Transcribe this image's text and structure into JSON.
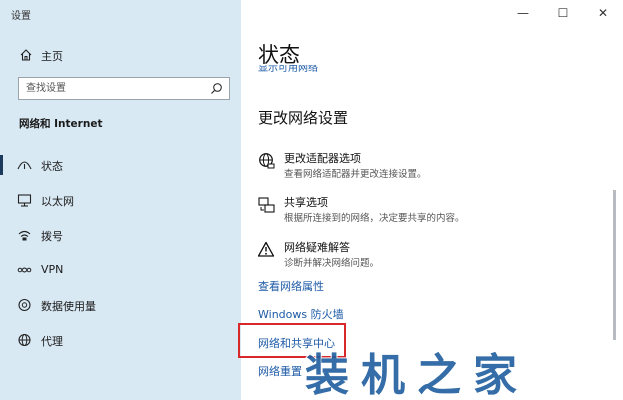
{
  "window": {
    "title": "设置"
  },
  "sidebar": {
    "home_label": "主页",
    "search_placeholder": "查找设置",
    "section_title": "网络和 Internet",
    "items": [
      {
        "label": "状态",
        "icon": "status-icon",
        "active": true
      },
      {
        "label": "以太网",
        "icon": "ethernet-icon"
      },
      {
        "label": "拨号",
        "icon": "dialup-icon"
      },
      {
        "label": "VPN",
        "icon": "vpn-icon"
      },
      {
        "label": "数据使用量",
        "icon": "data-usage-icon"
      },
      {
        "label": "代理",
        "icon": "proxy-icon"
      }
    ]
  },
  "window_controls": {
    "minimize": "—",
    "maximize": "☐",
    "close": "✕"
  },
  "main": {
    "title": "状态",
    "cut_link": "显示可用网络",
    "subtitle": "更改网络设置",
    "options": [
      {
        "title": "更改适配器选项",
        "desc": "查看网络适配器并更改连接设置。",
        "icon": "adapter-globe-icon"
      },
      {
        "title": "共享选项",
        "desc": "根据所连接到的网络，决定要共享的内容。",
        "icon": "sharing-icon"
      },
      {
        "title": "网络疑难解答",
        "desc": "诊断并解决网络问题。",
        "icon": "warning-icon"
      }
    ],
    "links": {
      "view_properties": "查看网络属性",
      "firewall": "Windows 防火墙",
      "sharing_center": "网络和共享中心",
      "reset": "网络重置"
    }
  },
  "watermark": "装机之家",
  "colors": {
    "sidebar_bg": "#d9e9f4",
    "link": "#1c5aa6",
    "highlight_border": "#d8282a"
  }
}
